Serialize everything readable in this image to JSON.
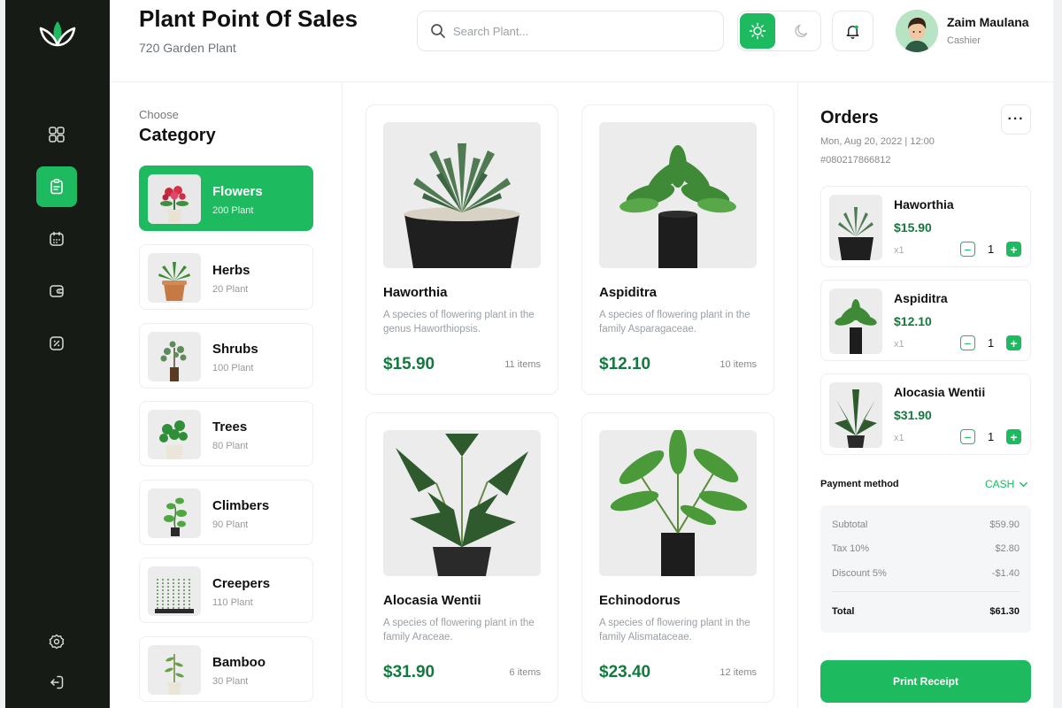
{
  "header": {
    "title": "Plant Point Of Sales",
    "subtitle": "720 Garden Plant",
    "search_placeholder": "Search Plant...",
    "user_name": "Zaim Maulana",
    "user_role": "Cashier"
  },
  "sidebar": {
    "items": [
      {
        "icon": "grid-icon"
      },
      {
        "icon": "clipboard-icon",
        "active": true
      },
      {
        "icon": "calendar-icon"
      },
      {
        "icon": "wallet-icon"
      },
      {
        "icon": "percent-icon"
      },
      {
        "icon": "settings-icon"
      },
      {
        "icon": "logout-icon"
      }
    ]
  },
  "categories": {
    "choose_label": "Choose",
    "heading": "Category",
    "items": [
      {
        "name": "Flowers",
        "count": "200 Plant",
        "active": true
      },
      {
        "name": "Herbs",
        "count": "20 Plant"
      },
      {
        "name": "Shrubs",
        "count": "100 Plant"
      },
      {
        "name": "Trees",
        "count": "80 Plant"
      },
      {
        "name": "Climbers",
        "count": "90 Plant"
      },
      {
        "name": "Creepers",
        "count": "110 Plant"
      },
      {
        "name": "Bamboo",
        "count": "30 Plant"
      }
    ]
  },
  "products": [
    {
      "name": "Haworthia",
      "desc": "A species of flowering plant in the genus Haworthiopsis.",
      "price": "$15.90",
      "stock": "11 items"
    },
    {
      "name": "Aspiditra",
      "desc": "A species of flowering plant in the family Asparagaceae.",
      "price": "$12.10",
      "stock": "10 items"
    },
    {
      "name": "Alocasia Wentii",
      "desc": "A species of flowering plant in the family Araceae.",
      "price": "$31.90",
      "stock": "6 items"
    },
    {
      "name": "Echinodorus",
      "desc": "A species of flowering plant in the family Alismataceae.",
      "price": "$23.40",
      "stock": "12 items"
    }
  ],
  "orders": {
    "title": "Orders",
    "date": "Mon, Aug 20, 2022 | 12:00",
    "id": "#080217866812",
    "more_label": "···",
    "items": [
      {
        "name": "Haworthia",
        "price": "$15.90",
        "qty_label": "x1",
        "qty": "1"
      },
      {
        "name": "Aspiditra",
        "price": "$12.10",
        "qty_label": "x1",
        "qty": "1"
      },
      {
        "name": "Alocasia Wentii",
        "price": "$31.90",
        "qty_label": "x1",
        "qty": "1"
      }
    ],
    "payment_label": "Payment method",
    "payment_value": "CASH",
    "summary": {
      "subtotal_label": "Subtotal",
      "subtotal": "$59.90",
      "tax_label": "Tax 10%",
      "tax": "$2.80",
      "discount_label": "Discount 5%",
      "discount": "-$1.40",
      "total_label": "Total",
      "total": "$61.30"
    },
    "print_label": "Print Receipt"
  },
  "colors": {
    "accent": "#1dba60",
    "price_green": "#137a3f",
    "sidebar": "#161b16"
  }
}
